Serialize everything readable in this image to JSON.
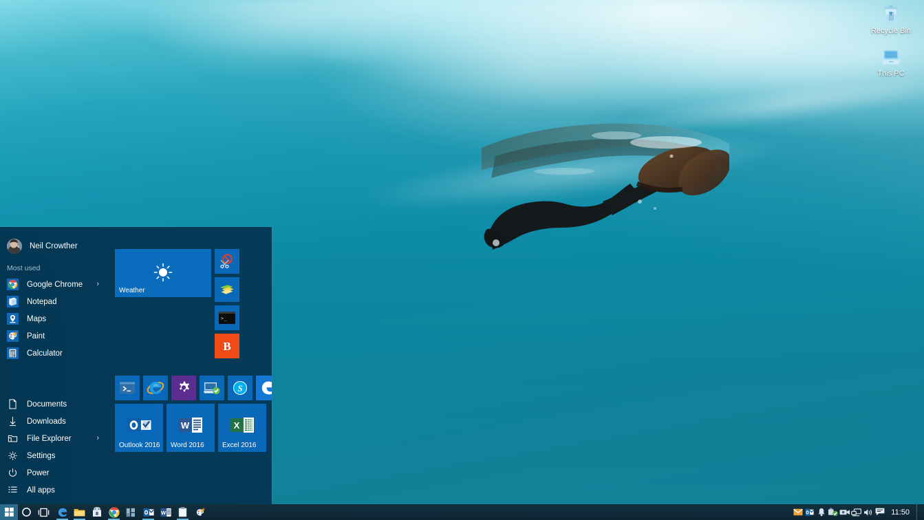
{
  "desktop": {
    "wallpaper_description": "Underwater photo of a freediver with fins near the ocean surface",
    "wallpaper_colors": {
      "deep_teal": "#0c8ba6",
      "surface_aqua": "#6fd4e4",
      "highlight_white": "#eafbff"
    },
    "icons": [
      {
        "name": "recycle-bin",
        "label": "Recycle Bin",
        "icon": "recycle-bin-icon"
      },
      {
        "name": "this-pc",
        "label": "This PC",
        "icon": "computer-icon"
      }
    ]
  },
  "start_menu": {
    "background_color": "#053a58",
    "user": {
      "name": "Neil Crowther",
      "avatar": "user-avatar"
    },
    "most_used": {
      "title": "Most used",
      "items": [
        {
          "label": "Google Chrome",
          "icon": "chrome-icon",
          "has_submenu": true
        },
        {
          "label": "Notepad",
          "icon": "notepad-icon",
          "has_submenu": false
        },
        {
          "label": "Maps",
          "icon": "maps-icon",
          "has_submenu": false
        },
        {
          "label": "Paint",
          "icon": "paint-icon",
          "has_submenu": false
        },
        {
          "label": "Calculator",
          "icon": "calculator-icon",
          "has_submenu": false
        }
      ]
    },
    "places": [
      {
        "label": "Documents",
        "icon": "document-icon",
        "has_submenu": false
      },
      {
        "label": "Downloads",
        "icon": "download-arrow-icon",
        "has_submenu": false
      },
      {
        "label": "File Explorer",
        "icon": "folder-explorer-icon",
        "has_submenu": true
      },
      {
        "label": "Settings",
        "icon": "gear-icon",
        "has_submenu": false
      },
      {
        "label": "Power",
        "icon": "power-icon",
        "has_submenu": false
      },
      {
        "label": "All apps",
        "icon": "all-apps-list-icon",
        "has_submenu": false
      }
    ],
    "tile_groups": [
      {
        "group_index": 1,
        "tiles": [
          {
            "label": "Weather",
            "size": "wide",
            "icon": "sun-icon",
            "color": "#0a6cbd"
          },
          {
            "label": "",
            "size": "small",
            "icon": "snipping-tool-icon",
            "color": "#0a68b8"
          },
          {
            "label": "",
            "size": "small",
            "icon": "sticky-notes-icon",
            "color": "#0a68b8"
          },
          {
            "label": "",
            "size": "small",
            "icon": "command-prompt-icon",
            "color": "#0a68b8"
          },
          {
            "label": "",
            "size": "small",
            "icon": "bitdefender-b-icon",
            "color": "#f04b16"
          }
        ]
      },
      {
        "group_index": 2,
        "tiles": [
          {
            "label": "",
            "size": "small",
            "icon": "powershell-icon",
            "color": "#0a68b8"
          },
          {
            "label": "",
            "size": "small",
            "icon": "internet-explorer-icon",
            "color": "#0a68b8"
          },
          {
            "label": "",
            "size": "small",
            "icon": "gear-icon",
            "color": "#5b2d91"
          },
          {
            "label": "",
            "size": "small",
            "icon": "remote-desktop-icon",
            "color": "#0a68b8"
          },
          {
            "label": "",
            "size": "small",
            "icon": "skype-icon",
            "color": "#0a68b8"
          },
          {
            "label": "",
            "size": "small",
            "icon": "edge-icon",
            "color": "#1478d4"
          },
          {
            "label": "Outlook 2016",
            "size": "medium",
            "icon": "outlook-icon",
            "color": "#0a68b8"
          },
          {
            "label": "Word 2016",
            "size": "medium",
            "icon": "word-icon",
            "color": "#0a68b8"
          },
          {
            "label": "Excel 2016",
            "size": "medium",
            "icon": "excel-icon",
            "color": "#0a68b8"
          }
        ]
      }
    ]
  },
  "taskbar": {
    "background_color": "#10222e",
    "start_button": {
      "name": "start-button",
      "icon": "windows-logo-icon",
      "active": true
    },
    "search": {
      "name": "cortana-search-button",
      "icon": "cortana-circle-icon"
    },
    "task_view": {
      "name": "task-view-button",
      "icon": "task-view-icon"
    },
    "pinned": [
      {
        "label": "Microsoft Edge",
        "icon": "edge-icon",
        "running": true
      },
      {
        "label": "File Explorer",
        "icon": "folder-icon",
        "running": true
      },
      {
        "label": "Store",
        "icon": "store-icon",
        "running": false
      },
      {
        "label": "Google Chrome",
        "icon": "chrome-icon",
        "running": true
      },
      {
        "label": "Server Manager",
        "icon": "server-manager-icon",
        "running": false
      },
      {
        "label": "Outlook",
        "icon": "outlook-icon",
        "running": true
      },
      {
        "label": "Word",
        "icon": "word-icon",
        "running": false
      },
      {
        "label": "Notepad",
        "icon": "notepad-icon",
        "running": true
      },
      {
        "label": "Paint",
        "icon": "paint-icon",
        "running": false
      }
    ],
    "tray": [
      {
        "label": "Mail",
        "icon": "envelope-icon"
      },
      {
        "label": "Outlook",
        "icon": "outlook-icon"
      },
      {
        "label": "Notifications",
        "icon": "bell-icon"
      },
      {
        "label": "Safely Remove Hardware",
        "icon": "usb-eject-icon"
      },
      {
        "label": "Camera",
        "icon": "camera-icon"
      },
      {
        "label": "Network",
        "icon": "network-icon"
      },
      {
        "label": "Volume",
        "icon": "speaker-icon"
      },
      {
        "label": "Action Center",
        "icon": "action-center-icon"
      }
    ],
    "clock": {
      "time": "11:50"
    },
    "show_desktop": {
      "name": "show-desktop-button"
    }
  }
}
